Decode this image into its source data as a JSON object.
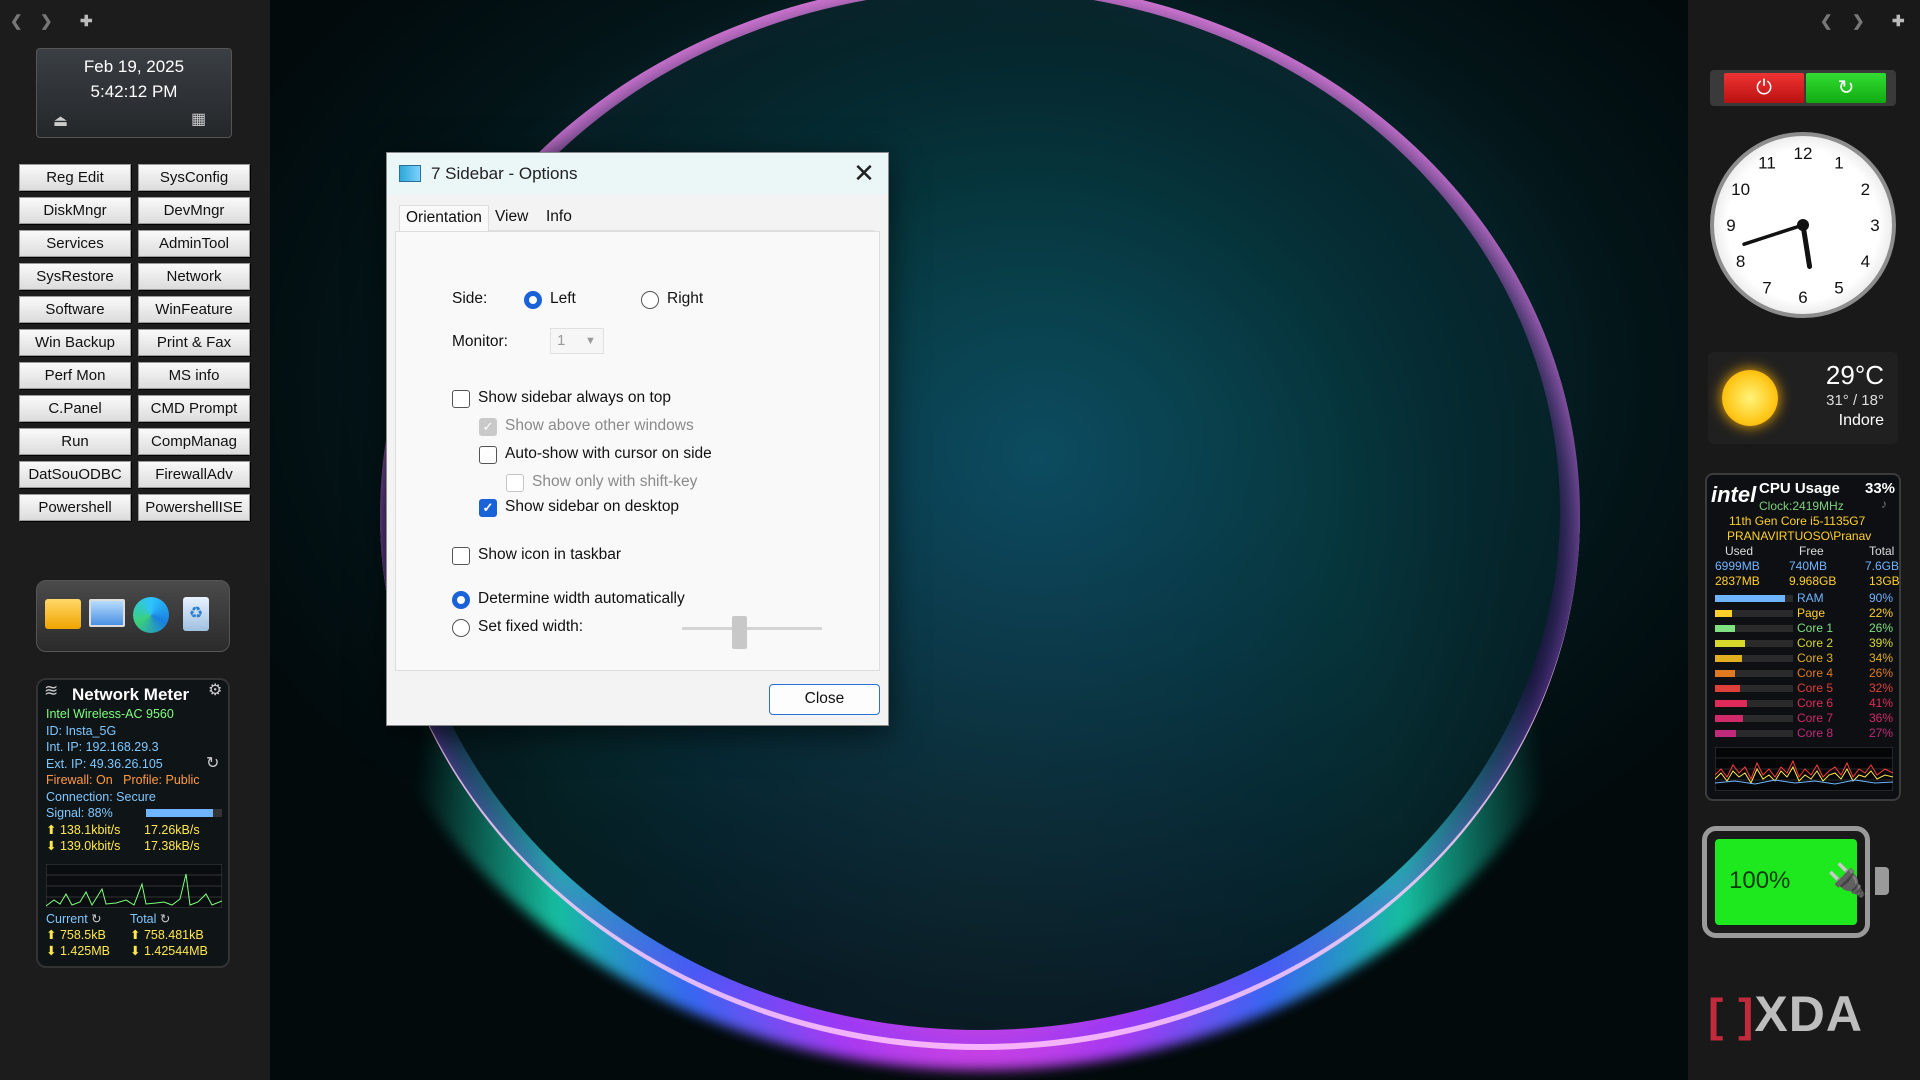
{
  "left_sidebar": {
    "nav_back": "❮",
    "nav_forward": "❯",
    "nav_add": "✚",
    "date": "Feb 19, 2025",
    "time": "5:42:12 PM",
    "buttons": [
      [
        "Reg Edit",
        "SysConfig"
      ],
      [
        "DiskMngr",
        "DevMngr"
      ],
      [
        "Services",
        "AdminTool"
      ],
      [
        "SysRestore",
        "Network"
      ],
      [
        "Software",
        "WinFeature"
      ],
      [
        "Win Backup",
        "Print & Fax"
      ],
      [
        "Perf Mon",
        "MS info"
      ],
      [
        "C.Panel",
        "CMD Prompt"
      ],
      [
        "Run",
        "CompManag"
      ],
      [
        "DatSouODBC",
        "FirewallAdv"
      ],
      [
        "Powershell",
        "PowershellISE"
      ]
    ],
    "tray_icons": [
      "folder-icon",
      "monitor-icon",
      "edge-browser-icon",
      "recycle-bin-icon"
    ]
  },
  "network_meter": {
    "title": "Network Meter",
    "adapter": "Intel Wireless-AC 9560",
    "id": "ID: Insta_5G",
    "int_ip": "Int. IP: 192.168.29.3",
    "ext_ip": "Ext. IP: 49.36.26.105",
    "firewall": "Firewall: On",
    "profile": "Profile: Public",
    "connection": "Connection: Secure",
    "signal": "Signal: 88%",
    "signal_value": 88,
    "up_rate": "138.1kbit/s",
    "up_bytes": "17.26kB/s",
    "down_rate": "139.0kbit/s",
    "down_bytes": "17.38kB/s",
    "current_label": "Current",
    "total_label": "Total",
    "current_up": "758.5kB",
    "current_down": "1.425MB",
    "total_up": "758.481kB",
    "total_down": "1.42544MB"
  },
  "dialog": {
    "title": "7 Sidebar - Options",
    "tabs": [
      "Orientation",
      "View",
      "Info"
    ],
    "active_tab": "Orientation",
    "side_label": "Side:",
    "side_left": "Left",
    "side_right": "Right",
    "monitor_label": "Monitor:",
    "monitor_value": "1",
    "opt_always_on_top": "Show sidebar always on top",
    "opt_above_other": "Show above other windows",
    "opt_autoshow": "Auto-show with cursor on side",
    "opt_shift_key": "Show only with shift-key",
    "opt_on_desktop": "Show sidebar on desktop",
    "opt_icon_taskbar": "Show icon in taskbar",
    "opt_width_auto": "Determine width automatically",
    "opt_fixed_width": "Set fixed width:",
    "close_button": "Close"
  },
  "right_sidebar": {
    "nav_back": "❮",
    "nav_forward": "❯",
    "nav_add": "✚",
    "clock_numbers": [
      "12",
      "1",
      "2",
      "3",
      "4",
      "5",
      "6",
      "7",
      "8",
      "9",
      "10",
      "11"
    ],
    "clock_time": "5:42",
    "weather": {
      "temp": "29°C",
      "range": "31° / 18°",
      "city": "Indore"
    },
    "cpu": {
      "brand": "intel",
      "title": "CPU Usage",
      "usage": "33%",
      "clock": "Clock:2419MHz",
      "model": "11th Gen Core i5-1135G7",
      "user": "PRANAVIRTUOSO\\Pranav",
      "headers": [
        "Used",
        "Free",
        "Total"
      ],
      "mem_row1": [
        "6999MB",
        "740MB",
        "7.6GB"
      ],
      "mem_row2": [
        "2837MB",
        "9.968GB",
        "13GB"
      ],
      "bars": [
        {
          "name": "RAM",
          "value": "90%",
          "pct": 90,
          "color": "#6fb4ff"
        },
        {
          "name": "Page",
          "value": "22%",
          "pct": 22,
          "color": "#ffd02a"
        },
        {
          "name": "Core 1",
          "value": "26%",
          "pct": 26,
          "color": "#7fe07f"
        },
        {
          "name": "Core 2",
          "value": "39%",
          "pct": 39,
          "color": "#d8d82a"
        },
        {
          "name": "Core 3",
          "value": "34%",
          "pct": 34,
          "color": "#e0b020"
        },
        {
          "name": "Core 4",
          "value": "26%",
          "pct": 26,
          "color": "#e07a20"
        },
        {
          "name": "Core 5",
          "value": "32%",
          "pct": 32,
          "color": "#e0403a"
        },
        {
          "name": "Core 6",
          "value": "41%",
          "pct": 41,
          "color": "#e02a5a"
        },
        {
          "name": "Core 7",
          "value": "36%",
          "pct": 36,
          "color": "#d02a6a"
        },
        {
          "name": "Core 8",
          "value": "27%",
          "pct": 27,
          "color": "#c02a7a"
        }
      ]
    },
    "battery": "100%",
    "brand_logo": "XDA"
  }
}
